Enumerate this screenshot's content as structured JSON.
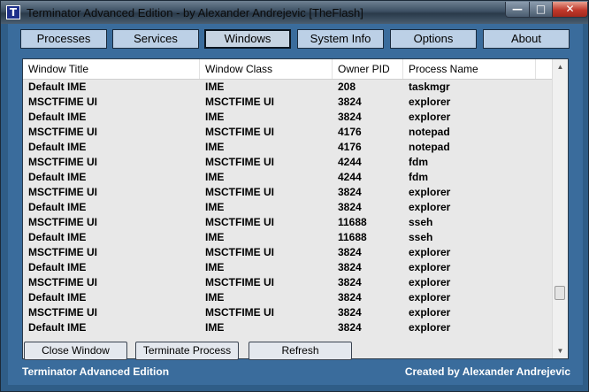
{
  "window": {
    "title": "Terminator Advanced Edition - by Alexander Andrejevic [TheFlash]",
    "icon_glyph": "T",
    "controls": {
      "minimize": "—",
      "maximize": "□",
      "close": "✕"
    }
  },
  "nav": {
    "tabs": [
      {
        "label": "Processes"
      },
      {
        "label": "Services"
      },
      {
        "label": "Windows"
      },
      {
        "label": "System Info"
      },
      {
        "label": "Options"
      },
      {
        "label": "About"
      }
    ],
    "active": "Windows"
  },
  "table": {
    "columns": [
      "Window Title",
      "Window Class",
      "Owner PID",
      "Process Name"
    ],
    "rows": [
      [
        "Default IME",
        "IME",
        "208",
        "taskmgr"
      ],
      [
        "MSCTFIME UI",
        "MSCTFIME UI",
        "3824",
        "explorer"
      ],
      [
        "Default IME",
        "IME",
        "3824",
        "explorer"
      ],
      [
        "MSCTFIME UI",
        "MSCTFIME UI",
        "4176",
        "notepad"
      ],
      [
        "Default IME",
        "IME",
        "4176",
        "notepad"
      ],
      [
        "MSCTFIME UI",
        "MSCTFIME UI",
        "4244",
        "fdm"
      ],
      [
        "Default IME",
        "IME",
        "4244",
        "fdm"
      ],
      [
        "MSCTFIME UI",
        "MSCTFIME UI",
        "3824",
        "explorer"
      ],
      [
        "Default IME",
        "IME",
        "3824",
        "explorer"
      ],
      [
        "MSCTFIME UI",
        "MSCTFIME UI",
        "11688",
        "sseh"
      ],
      [
        "Default IME",
        "IME",
        "11688",
        "sseh"
      ],
      [
        "MSCTFIME UI",
        "MSCTFIME UI",
        "3824",
        "explorer"
      ],
      [
        "Default IME",
        "IME",
        "3824",
        "explorer"
      ],
      [
        "MSCTFIME UI",
        "MSCTFIME UI",
        "3824",
        "explorer"
      ],
      [
        "Default IME",
        "IME",
        "3824",
        "explorer"
      ],
      [
        "MSCTFIME UI",
        "MSCTFIME UI",
        "3824",
        "explorer"
      ],
      [
        "Default IME",
        "IME",
        "3824",
        "explorer"
      ]
    ]
  },
  "scrollbar": {
    "up": "▲",
    "down": "▼"
  },
  "actions": {
    "close_window": "Close Window",
    "terminate_process": "Terminate Process",
    "refresh": "Refresh"
  },
  "status": {
    "left": "Terminator Advanced Edition",
    "right": "Created by Alexander Andrejevic"
  }
}
